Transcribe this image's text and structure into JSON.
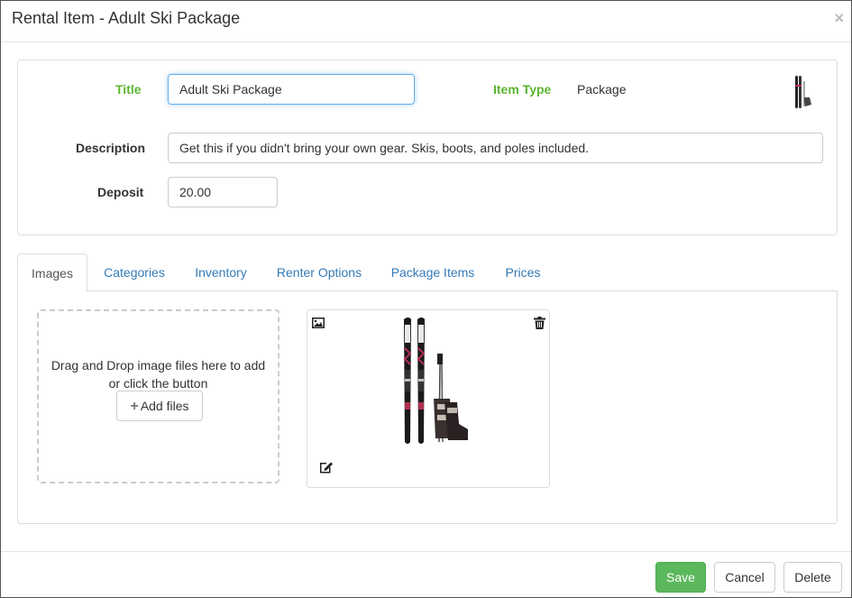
{
  "modal": {
    "title": "Rental Item - Adult Ski Package",
    "close_label": "×"
  },
  "form": {
    "title_label": "Title",
    "title_value": "Adult Ski Package",
    "item_type_label": "Item Type",
    "item_type_value": "Package",
    "description_label": "Description",
    "description_value": "Get this if you didn't bring your own gear. Skis, boots, and poles included.",
    "deposit_label": "Deposit",
    "deposit_value": "20.00"
  },
  "tabs": [
    {
      "label": "Images",
      "active": true
    },
    {
      "label": "Categories",
      "active": false
    },
    {
      "label": "Inventory",
      "active": false
    },
    {
      "label": "Renter Options",
      "active": false
    },
    {
      "label": "Package Items",
      "active": false
    },
    {
      "label": "Prices",
      "active": false
    }
  ],
  "images_tab": {
    "dropzone_text": "Drag and Drop image files here to add or click the button",
    "add_files_label": "Add files",
    "icons": {
      "add": "plus-icon",
      "image": "image-icon",
      "delete": "trash-icon",
      "edit": "edit-icon"
    }
  },
  "footer": {
    "save_label": "Save",
    "cancel_label": "Cancel",
    "delete_label": "Delete"
  },
  "colors": {
    "label_green": "#5cb531",
    "link_blue": "#337ab7",
    "save_green": "#5cb85c"
  }
}
